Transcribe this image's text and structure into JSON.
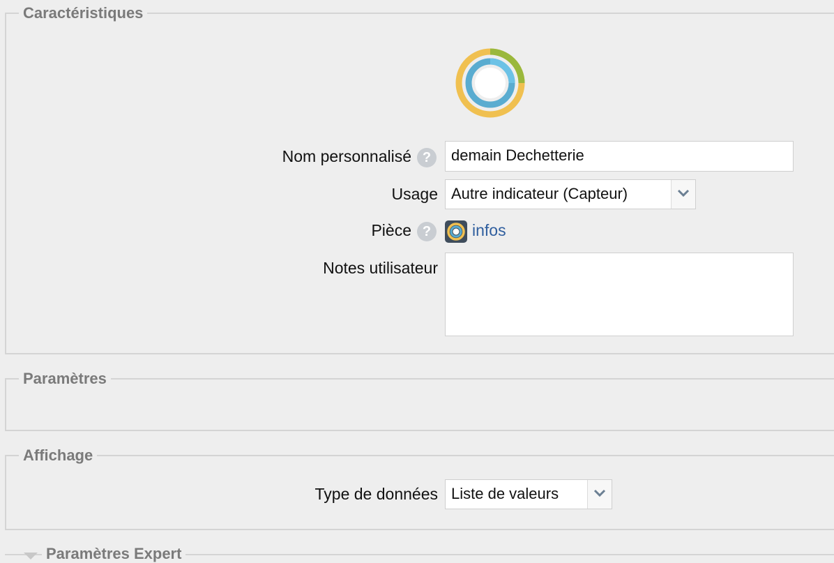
{
  "sections": {
    "characteristics": {
      "title": "Caractéristiques"
    },
    "parameters": {
      "title": "Paramètres"
    },
    "display": {
      "title": "Affichage"
    },
    "expert": {
      "title": "Paramètres Expert"
    }
  },
  "form": {
    "custom_name_label": "Nom personnalisé",
    "custom_name_value": "demain Dechetterie",
    "usage_label": "Usage",
    "usage_value": "Autre indicateur (Capteur)",
    "room_label": "Pièce",
    "room_link": "infos",
    "notes_label": "Notes utilisateur",
    "notes_value": "",
    "data_type_label": "Type de données",
    "data_type_value": "Liste de valeurs"
  },
  "help_glyph": "?",
  "colors": {
    "ring_yellow": "#f0c050",
    "ring_green": "#9ab83c",
    "ring_blue": "#5aacd0",
    "link": "#2f5e9e"
  },
  "icons": {
    "device": "ring-gauge-icon",
    "room": "room-ring-icon",
    "help": "help-icon",
    "dropdown": "chevron-down-icon",
    "collapse": "triangle-down-icon"
  }
}
